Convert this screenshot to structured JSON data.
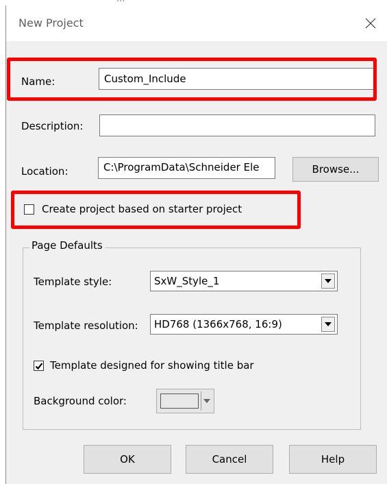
{
  "background_hint": "...",
  "dialog": {
    "title": "New Project",
    "close_symbol": "close-icon"
  },
  "form": {
    "name_label": "Name:",
    "name_value": "Custom_Include",
    "description_label": "Description:",
    "description_value": "",
    "location_label": "Location:",
    "location_value": "C:\\ProgramData\\Schneider Ele",
    "browse_label": "Browse...",
    "starter_checkbox_label": "Create project based on starter project",
    "starter_checked": false
  },
  "page_defaults": {
    "legend": "Page Defaults",
    "template_style_label": "Template style:",
    "template_style_value": "SxW_Style_1",
    "template_resolution_label": "Template resolution:",
    "template_resolution_value": "HD768 (1366x768, 16:9)",
    "title_bar_checkbox_label": "Template designed for showing title bar",
    "title_bar_checked": true,
    "background_color_label": "Background color:",
    "background_color_value": "#e8e8e8"
  },
  "buttons": {
    "ok": "OK",
    "cancel": "Cancel",
    "help": "Help"
  },
  "colors": {
    "highlight": "#ff0000",
    "dialog_bg": "#f0f0f0"
  }
}
